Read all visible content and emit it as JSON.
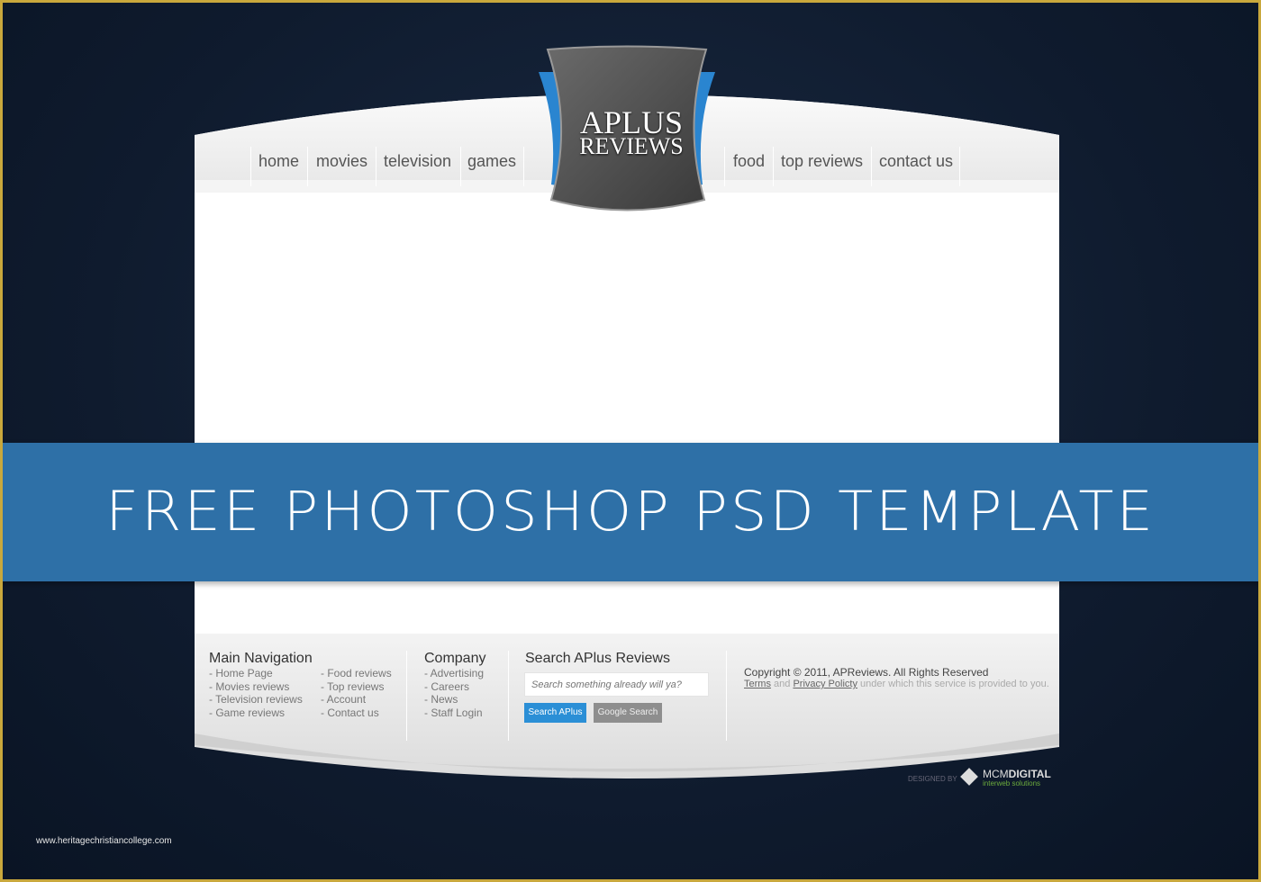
{
  "nav": {
    "left": [
      "home",
      "movies",
      "television",
      "games"
    ],
    "right": [
      "food",
      "top reviews",
      "contact us"
    ]
  },
  "logo": {
    "line1": "APLUS",
    "line2": "REVIEWS"
  },
  "banner": {
    "text": "FREE PHOTOSHOP PSD TEMPLATE"
  },
  "footer": {
    "main_nav": {
      "title": "Main Navigation",
      "col1": [
        "- Home Page",
        "- Movies reviews",
        "- Television reviews",
        "- Game reviews"
      ],
      "col2": [
        "- Food reviews",
        "- Top reviews",
        "- Account",
        "- Contact us"
      ]
    },
    "company": {
      "title": "Company",
      "items": [
        "- Advertising",
        "- Careers",
        "- News",
        "- Staff Login"
      ]
    },
    "search": {
      "title": "Search APlus Reviews",
      "placeholder": "Search something already will ya?",
      "search_button": "Search APlus",
      "google_button": "Google Search"
    },
    "copyright": "Copyright © 2011, APReviews. All Rights Reserved",
    "terms": "Terms",
    "and": "and",
    "privacy": "Privacy Policty",
    "rest": "under which this service is provided to you."
  },
  "credit": {
    "designed_by": "DESIGNED BY",
    "brand_a": "MCM",
    "brand_b": "DIGITAL",
    "tagline": "interweb solutions"
  },
  "watermark": "www.heritagechristiancollege.com",
  "colors": {
    "banner": "#2e70a7",
    "background": "#0f1b2e",
    "border": "#c9a83c",
    "accent_blue": "#2b8fd6"
  }
}
